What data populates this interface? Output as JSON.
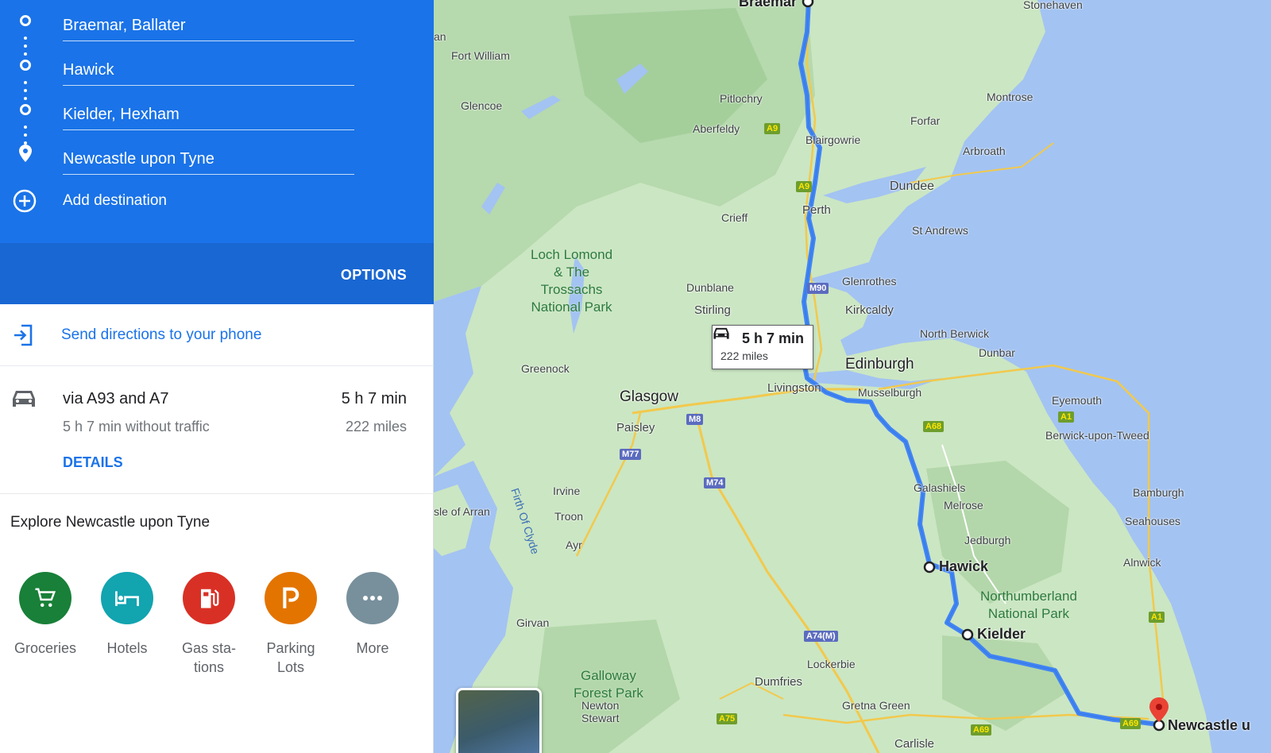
{
  "directions": {
    "stops": [
      {
        "value": "Braemar, Ballater",
        "icon": "circle-icon"
      },
      {
        "value": "Hawick",
        "icon": "circle-icon"
      },
      {
        "value": "Kielder, Hexham",
        "icon": "circle-icon"
      },
      {
        "value": "Newcastle upon Tyne",
        "icon": "pin-icon"
      }
    ],
    "add_destination": "Add destination",
    "options": "OPTIONS",
    "colors": {
      "header": "#1a73e8",
      "options_bar": "#1967d2"
    }
  },
  "send": {
    "label": "Send directions to your phone",
    "icon": "send-to-phone-icon"
  },
  "route": {
    "icon": "car-icon",
    "via": "via A93 and A7",
    "without_traffic": "5 h 7 min without traffic",
    "time": "5 h 7 min",
    "distance": "222 miles",
    "details": "DETAILS"
  },
  "explore": {
    "title": "Explore Newcastle upon Tyne",
    "categories": [
      {
        "label": "Groceries",
        "icon": "cart-icon",
        "color": "#188038"
      },
      {
        "label": "Hotels",
        "icon": "bed-icon",
        "color": "#12a4af"
      },
      {
        "label": "Gas sta-\ntions",
        "icon": "gas-pump-icon",
        "color": "#d93025"
      },
      {
        "label": "Parking\nLots",
        "icon": "parking-icon",
        "color": "#e37400"
      },
      {
        "label": "More",
        "icon": "more-icon",
        "color": "#78909c"
      }
    ]
  },
  "map": {
    "callout": {
      "time": "5 h 7 min",
      "distance": "222 miles"
    },
    "route_color": "#4285f4",
    "stop_labels": {
      "hawick": "Hawick",
      "kielder": "Kielder",
      "newcastle": "Newcastle u",
      "braemar": "Braemar"
    },
    "cities": {
      "edinburgh": "Edinburgh",
      "glasgow": "Glasgow",
      "dundee": "Dundee",
      "perth": "Perth",
      "stirling": "Stirling",
      "livingston": "Livingston",
      "kirkcaldy": "Kirkcaldy",
      "paisley": "Paisley",
      "dumfries": "Dumfries",
      "carlisle": "Carlisle",
      "fort_william": "Fort William",
      "glencoe": "Glencoe",
      "pitlochry": "Pitlochry",
      "aberfeldy": "Aberfeldy",
      "blairgowrie": "Blairgowrie",
      "crieff": "Crieff",
      "forfar": "Forfar",
      "montrose": "Montrose",
      "arbroath": "Arbroath",
      "st_andrews": "St Andrews",
      "dunblane": "Dunblane",
      "glenrothes": "Glenrothes",
      "north_berwick": "North Berwick",
      "dunbar": "Dunbar",
      "greenock": "Greenock",
      "musselburgh": "Musselburgh",
      "eyemouth": "Eyemouth",
      "berwick": "Berwick-upon-Tweed",
      "galashiels": "Galashiels",
      "melrose": "Melrose",
      "jedburgh": "Jedburgh",
      "bamburgh": "Bamburgh",
      "seahouses": "Seahouses",
      "alnwick": "Alnwick",
      "irvine": "Irvine",
      "troon": "Troon",
      "ayr": "Ayr",
      "girvan": "Girvan",
      "lockerbie": "Lockerbie",
      "gretna_green": "Gretna Green",
      "newton_stewart": "Newton\nStewart",
      "isle_of_arran": "sle of Arran",
      "stonehaven": "Stonehaven",
      "an": "an"
    },
    "parks": {
      "loch_lomond": "Loch Lomond\n& The\nTrossachs\nNational Park",
      "northumberland": "Northumberland\nNational Park",
      "galloway": "Galloway\nForest Park"
    },
    "water": {
      "firth_of_clyde": "Firth Of Clyde"
    },
    "roads": {
      "a9": "A9",
      "a9b": "A9",
      "m90": "M90",
      "m8": "M8",
      "m77": "M77",
      "m74": "M74",
      "a68": "A68",
      "a1": "A1",
      "a1b": "A1",
      "a74m": "A74(M)",
      "a75": "A75",
      "a69": "A69",
      "a69b": "A69"
    }
  }
}
